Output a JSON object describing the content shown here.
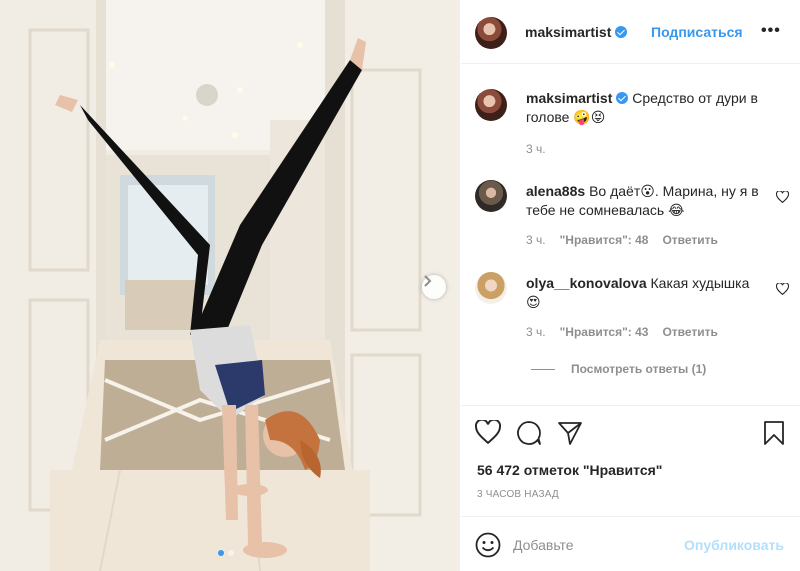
{
  "post": {
    "image_alt": "",
    "carousel": {
      "count": 2,
      "active_index": 0
    }
  },
  "header": {
    "username": "maksimartist",
    "verified": true,
    "follow_label": "Подписаться",
    "more_label": "•••",
    "verified_icon": "verified-badge-icon",
    "more_icon": "more-options-icon"
  },
  "caption": {
    "username": "maksimartist",
    "text": "Средство от дури в голове 🤪😝",
    "time": "3 ч."
  },
  "comments": [
    {
      "username": "alena88s",
      "text": "Во даёт😮. Марина, ну я в тебе не сомневалась 😂",
      "time": "3 ч.",
      "likes": "\"Нравится\": 48",
      "reply": "Ответить"
    },
    {
      "username": "olya__konovalova",
      "text": "Какая худышка 😍",
      "time": "3 ч.",
      "likes": "\"Нравится\": 43",
      "reply": "Ответить"
    }
  ],
  "view_replies": "Посмотреть ответы (1)",
  "actions": {
    "icons": [
      "heart-icon",
      "comment-icon",
      "share-icon",
      "bookmark-icon"
    ]
  },
  "likes_count": "56 472 отметок \"Нравится\"",
  "time_ago": "3 ЧАСОВ НАЗАД",
  "add_comment": {
    "placeholder": "Добавьте",
    "publish_label": "Опубликовать"
  },
  "colors": {
    "accent": "#3897f0",
    "publish_disabled": "#b2dffc",
    "muted": "#8e8e8e",
    "text": "#262626"
  }
}
